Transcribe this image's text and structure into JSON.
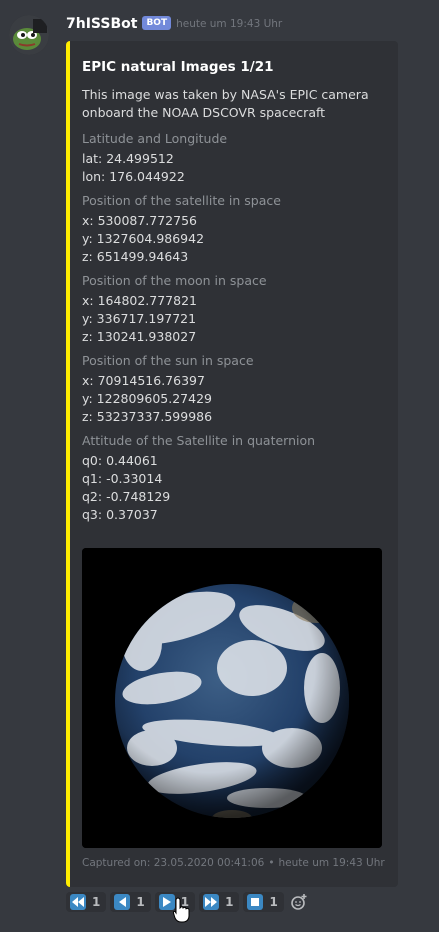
{
  "message": {
    "username": "7hISSBot",
    "bot_tag": "BOT",
    "timestamp": "heute um 19:43 Uhr"
  },
  "embed": {
    "color": "#ffed00",
    "title": "EPIC natural Images 1/21",
    "description": "This image was taken by NASA's EPIC camera\nonboard the NOAA DSCOVR spacecraft",
    "fields": [
      {
        "name": "Latitude and Longitude",
        "lines": [
          "lat: 24.499512",
          "lon: 176.044922"
        ]
      },
      {
        "name": "Position of the satellite in space",
        "lines": [
          "x: 530087.772756",
          "y: 1327604.986942",
          "z: 651499.94643"
        ]
      },
      {
        "name": "Position of the moon in space",
        "lines": [
          "x: 164802.777821",
          "y: 336717.197721",
          "z: 130241.938027"
        ]
      },
      {
        "name": "Position of the sun in space",
        "lines": [
          "x: 70914516.76397",
          "y: 122809605.27429",
          "z: 53237337.599986"
        ]
      },
      {
        "name": "Attitude of the Satellite in quaternion",
        "lines": [
          "q0: 0.44061",
          "q1: -0.33014",
          "q2: -0.748129",
          "q3: 0.37037"
        ]
      }
    ],
    "footer": {
      "captured": "Captured on: 23.05.2020 00:41:06",
      "separator": "•",
      "time": "heute um 19:43 Uhr"
    }
  },
  "reactions": [
    {
      "icon": "rewind-icon",
      "count": "1"
    },
    {
      "icon": "previous-icon",
      "count": "1"
    },
    {
      "icon": "play-icon",
      "count": "1"
    },
    {
      "icon": "fast-forward-icon",
      "count": "1"
    },
    {
      "icon": "stop-icon",
      "count": "1"
    }
  ],
  "colors": {
    "background": "#36393f",
    "embed_bg": "#2f3136",
    "reaction_emoji": "#3b88c3",
    "bot_tag": "#7289da"
  }
}
